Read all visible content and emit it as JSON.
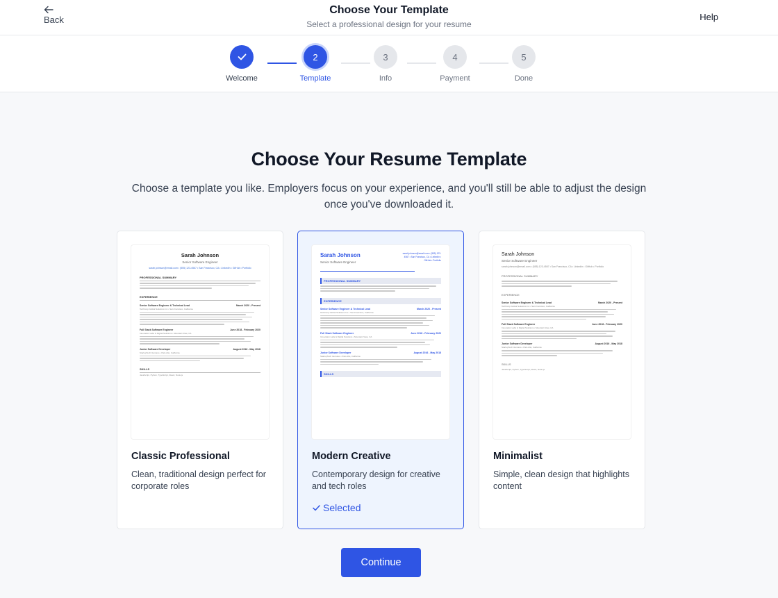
{
  "header": {
    "back_label": "Back",
    "title": "Choose Your Template",
    "subtitle": "Select a professional design for your resume",
    "help_label": "Help"
  },
  "steps": [
    {
      "number": "1",
      "label": "Welcome",
      "state": "done"
    },
    {
      "number": "2",
      "label": "Template",
      "state": "active"
    },
    {
      "number": "3",
      "label": "Info",
      "state": "todo"
    },
    {
      "number": "4",
      "label": "Payment",
      "state": "todo"
    },
    {
      "number": "5",
      "label": "Done",
      "state": "todo"
    }
  ],
  "main": {
    "heading": "Choose Your Resume Template",
    "subheading": "Choose a template you like. Employers focus on your experience, and you'll still be able to adjust the design once you've downloaded it.",
    "continue_label": "Continue"
  },
  "templates": [
    {
      "name": "Classic Professional",
      "description": "Clean, traditional design perfect for corporate roles",
      "selected": false
    },
    {
      "name": "Modern Creative",
      "description": "Contemporary design for creative and tech roles",
      "selected": true,
      "selected_label": "Selected"
    },
    {
      "name": "Minimalist",
      "description": "Simple, clean design that highlights content",
      "selected": false
    }
  ],
  "resume_preview": {
    "name": "Sarah Johnson",
    "role": "Senior Software Engineer",
    "contact": "sarah.johnson@email.com • (555) 123-4567 • San Francisco, CA • LinkedIn • GitHub • Portfolio",
    "section_summary": "PROFESSIONAL SUMMARY",
    "section_experience": "EXPERIENCE",
    "section_skills": "SKILLS",
    "job1": "Senior Software Engineer & Technical Lead",
    "job1_date": "March 2020 - Present",
    "job1_company": "TechCorp Global Solutions Inc • San Francisco, California",
    "job2": "Full Stack Software Engineer",
    "job2_date": "June 2018 - February 2020",
    "job2_company": "Innovation Labs & Digital Solutions • Mountain View, CA",
    "job3": "Junior Software Developer",
    "job3_date": "August 2016 - May 2018",
    "job3_company": "StartupTech Ventures • Palo Alto, California",
    "skills_line": "JavaScript, Python, TypeScript, React, Node.js"
  },
  "colors": {
    "accent": "#2f55e4",
    "selected_card_bg": "#eef4fe",
    "page_bg": "#f7f8fa"
  }
}
